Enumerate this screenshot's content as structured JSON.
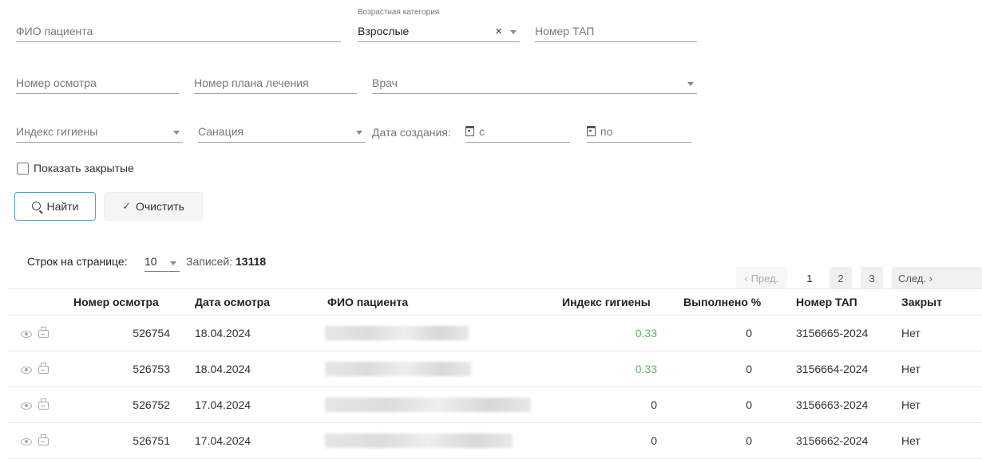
{
  "filters": {
    "patient_name_placeholder": "ФИО пациента",
    "age_category_label": "Возрастная категория",
    "age_category_value": "Взрослые",
    "tap_number_placeholder": "Номер ТАП",
    "exam_number_placeholder": "Номер осмотра",
    "plan_number_placeholder": "Номер плана лечения",
    "doctor_placeholder": "Врач",
    "hygiene_index_placeholder": "Индекс гигиены",
    "sanation_placeholder": "Санация",
    "created_date_label": "Дата создания:",
    "date_from_placeholder": "с",
    "date_to_placeholder": "по",
    "show_closed_label": "Показать закрытые"
  },
  "actions": {
    "find_label": "Найти",
    "clear_label": "Очистить"
  },
  "pagination": {
    "rows_per_page_label": "Строк на странице:",
    "rows_per_page_value": "10",
    "records_label": "Записей:",
    "records_count": "13118",
    "prev_label": "‹ Пред.",
    "next_label": "След. ›",
    "pages": [
      "1",
      "2",
      "3"
    ]
  },
  "table": {
    "headers": {
      "exam_number": "Номер осмотра",
      "exam_date": "Дата осмотра",
      "patient_name": "ФИО пациента",
      "hygiene_index": "Индекс гигиены",
      "completed_pct": "Выполнено %",
      "tap_number": "Номер ТАП",
      "closed": "Закрыт"
    },
    "rows": [
      {
        "exam_number": "526754",
        "exam_date": "18.04.2024",
        "hygiene_index": "0.33",
        "completed_pct": "0",
        "tap_number": "3156665-2024",
        "closed": "Нет"
      },
      {
        "exam_number": "526753",
        "exam_date": "18.04.2024",
        "hygiene_index": "0.33",
        "completed_pct": "0",
        "tap_number": "3156664-2024",
        "closed": "Нет"
      },
      {
        "exam_number": "526752",
        "exam_date": "17.04.2024",
        "hygiene_index": "0",
        "completed_pct": "0",
        "tap_number": "3156663-2024",
        "closed": "Нет"
      },
      {
        "exam_number": "526751",
        "exam_date": "17.04.2024",
        "hygiene_index": "0",
        "completed_pct": "0",
        "tap_number": "3156662-2024",
        "closed": "Нет"
      }
    ]
  },
  "colors": {
    "accent": "#4aa6c6",
    "positive_index": "#5cb85c"
  }
}
